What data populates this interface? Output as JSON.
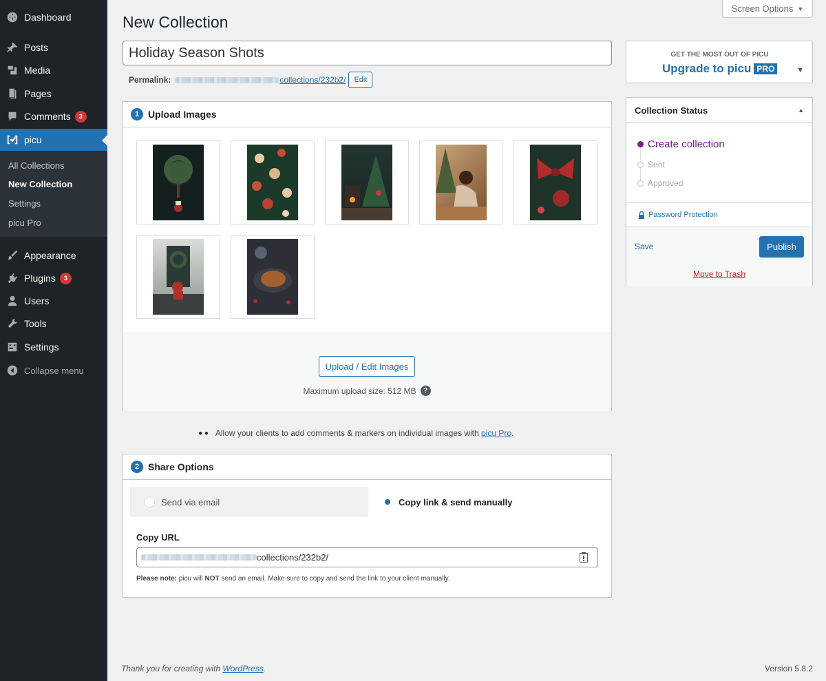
{
  "sidebar": {
    "items": [
      {
        "label": "Dashboard",
        "icon": "dashboard-icon"
      },
      {
        "label": "Posts",
        "icon": "pin-icon"
      },
      {
        "label": "Media",
        "icon": "media-icon"
      },
      {
        "label": "Pages",
        "icon": "pages-icon"
      },
      {
        "label": "Comments",
        "icon": "comment-icon",
        "badge": "3"
      },
      {
        "label": "picu",
        "icon": "picu-icon",
        "active": true
      },
      {
        "label": "Appearance",
        "icon": "brush-icon"
      },
      {
        "label": "Plugins",
        "icon": "plugin-icon",
        "badge": "3"
      },
      {
        "label": "Users",
        "icon": "user-icon"
      },
      {
        "label": "Tools",
        "icon": "wrench-icon"
      },
      {
        "label": "Settings",
        "icon": "settings-icon"
      },
      {
        "label": "Collapse menu",
        "icon": "collapse-icon"
      }
    ],
    "submenu": [
      "All Collections",
      "New Collection",
      "Settings",
      "picu Pro"
    ],
    "current_submenu": "New Collection"
  },
  "top": {
    "screen_options": "Screen Options",
    "page_title": "New Collection"
  },
  "editor": {
    "title_value": "Holiday Season Shots",
    "permalink_label": "Permalink:",
    "permalink_path": "collections/232b2/",
    "edit_label": "Edit"
  },
  "upload": {
    "step": "1",
    "heading": "Upload Images",
    "button": "Upload / Edit Images",
    "max_size": "Maximum upload size: 512 MB",
    "help": "?",
    "images": [
      {
        "name": "wreath-door"
      },
      {
        "name": "tree-baubles"
      },
      {
        "name": "living-room-tree"
      },
      {
        "name": "girl-fairy-lights"
      },
      {
        "name": "red-bow-ornament"
      },
      {
        "name": "santa-porch"
      },
      {
        "name": "roast-dinner"
      }
    ]
  },
  "pro_note": {
    "text": "Allow your clients to add comments & markers on individual images with",
    "link": "picu Pro",
    "suffix": "."
  },
  "share": {
    "step": "2",
    "heading": "Share Options",
    "tab_email": "Send via email",
    "tab_copy": "Copy link & send manually",
    "copy_url_label": "Copy URL",
    "copy_url_path": "collections/232b2/",
    "note_bold": "Please note:",
    "note_mid": " picu will ",
    "note_not": "NOT",
    "note_rest": " send an email. Make sure to copy and send the link to your client manually."
  },
  "upgrade": {
    "small": "GET THE MOST OUT OF PICU",
    "big": "Upgrade to picu",
    "tag": "PRO",
    "caret": "▼"
  },
  "status": {
    "heading": "Collection Status",
    "caret": "▲",
    "steps": [
      "Create collection",
      "Sent",
      "Approved"
    ],
    "password": "Password Protection",
    "save": "Save",
    "publish": "Publish",
    "trash": "Move to Trash"
  },
  "footer": {
    "thanks": "Thank you for creating with",
    "link": "WordPress",
    "period": ".",
    "version": "Version 5.8.2"
  },
  "colors": {
    "accent": "#2271b1",
    "sidebar": "#1d2327",
    "status_active": "#7b1c8e",
    "danger": "#b32d2e"
  }
}
